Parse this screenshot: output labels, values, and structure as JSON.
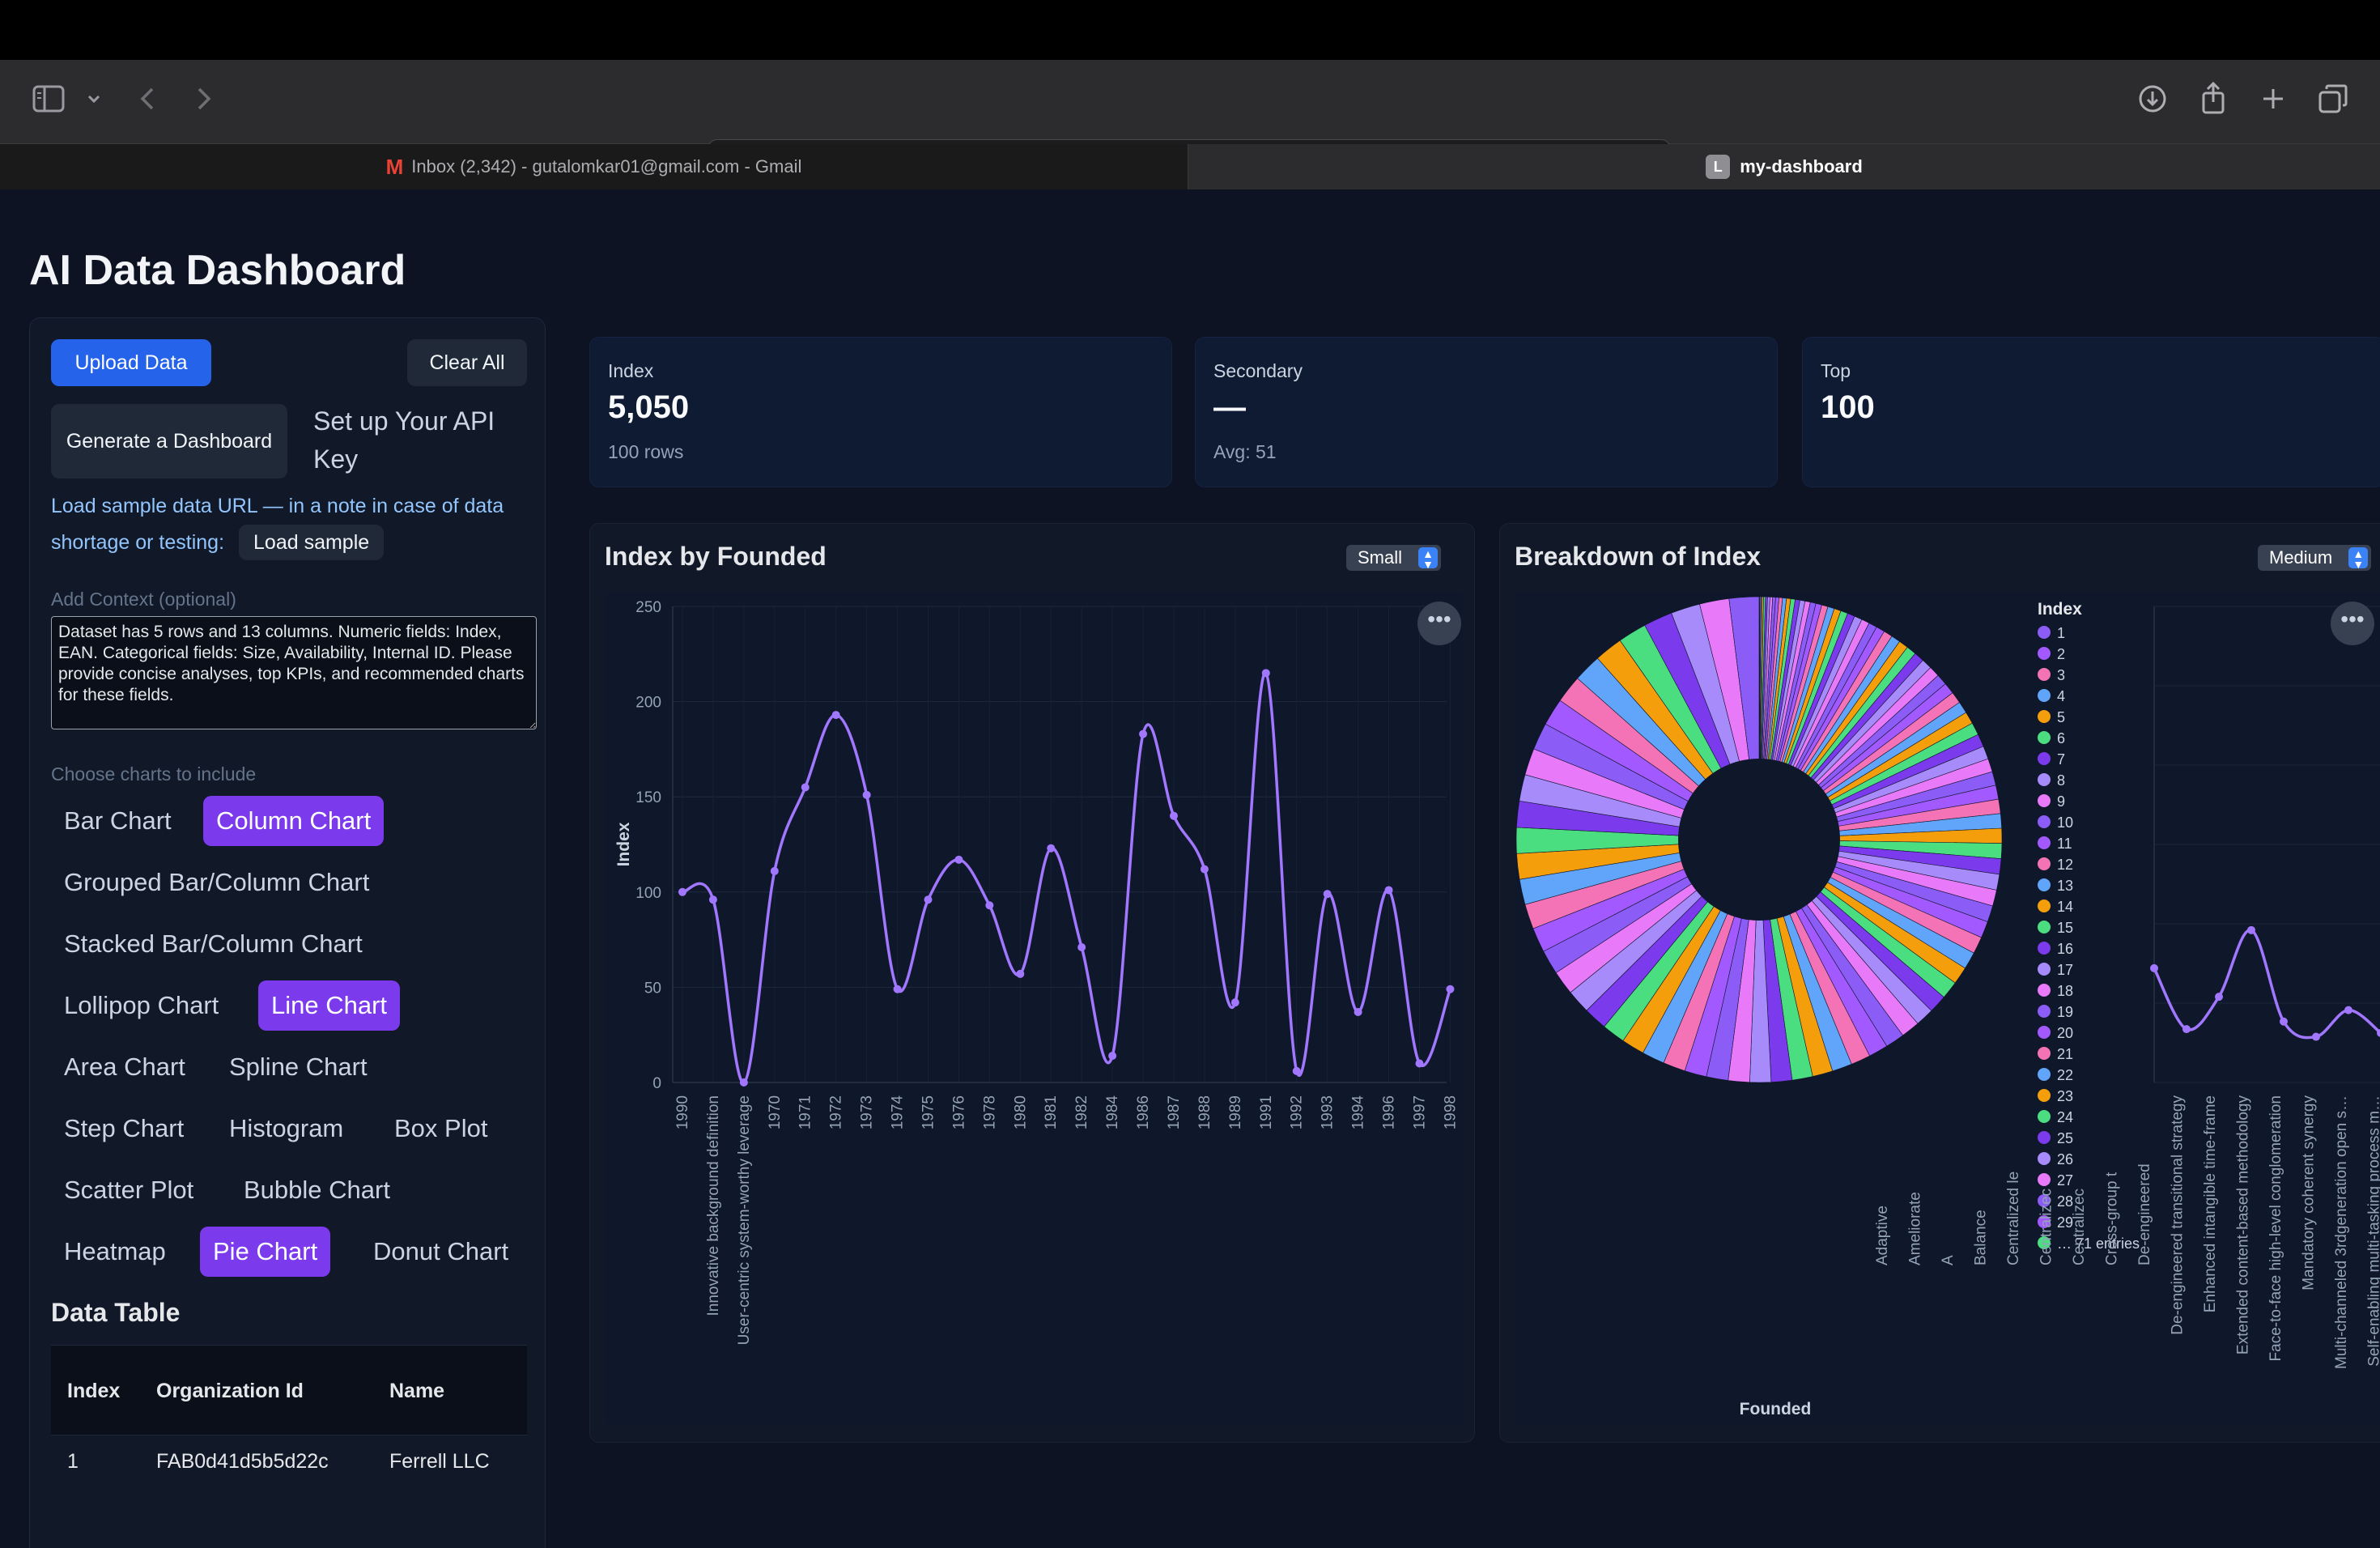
{
  "browser": {
    "url": "localhost",
    "tabs": [
      {
        "title": "Inbox (2,342) - gutalomkar01@gmail.com - Gmail",
        "favicon": "M"
      },
      {
        "title": "my-dashboard",
        "favicon": "L"
      }
    ]
  },
  "page_title": "AI Data Dashboard",
  "sidebar": {
    "upload_label": "Upload Data",
    "clear_label": "Clear All",
    "generate_label": "Generate a Dashboard",
    "api_link": "Set up Your API Key",
    "sample_note": "Load sample data URL — in a note in case of data shortage or testing:",
    "load_sample_label": "Load sample",
    "context_label": "Add Context (optional)",
    "context_value": "Dataset has 5 rows and 13 columns. Numeric fields: Index, EAN. Categorical fields: Size, Availability, Internal ID. Please provide concise analyses, top KPIs, and recommended charts for these fields.",
    "choose_label": "Choose charts to include",
    "chart_options": [
      {
        "label": "Bar Chart",
        "selected": false
      },
      {
        "label": "Column Chart",
        "selected": true
      },
      {
        "label": "Grouped Bar/Column Chart",
        "selected": false
      },
      {
        "label": "Stacked Bar/Column Chart",
        "selected": false
      },
      {
        "label": "Lollipop Chart",
        "selected": false
      },
      {
        "label": "Line Chart",
        "selected": true
      },
      {
        "label": "Area Chart",
        "selected": false
      },
      {
        "label": "Spline Chart",
        "selected": false
      },
      {
        "label": "Step Chart",
        "selected": false
      },
      {
        "label": "Histogram",
        "selected": false
      },
      {
        "label": "Box Plot",
        "selected": false
      },
      {
        "label": "Scatter Plot",
        "selected": false
      },
      {
        "label": "Bubble Chart",
        "selected": false
      },
      {
        "label": "Heatmap",
        "selected": false
      },
      {
        "label": "Pie Chart",
        "selected": true
      },
      {
        "label": "Donut Chart",
        "selected": false
      }
    ],
    "table_title": "Data Table",
    "table_headers": [
      "Index",
      "Organization Id",
      "Name"
    ],
    "table_rows": [
      [
        "1",
        "FAB0d41d5b5d22c",
        "Ferrell LLC"
      ]
    ]
  },
  "kpis": [
    {
      "label": "Index",
      "value": "5,050",
      "sub": "100 rows"
    },
    {
      "label": "Secondary",
      "value": "—",
      "sub": "Avg: 51"
    },
    {
      "label": "Top",
      "value": "100",
      "sub": ""
    }
  ],
  "cards": [
    {
      "title": "Index by Founded",
      "size": "Small"
    },
    {
      "title": "Breakdown of Index",
      "size": "Medium"
    }
  ],
  "icons": [
    "sidebar-icon",
    "chevron-down-icon",
    "back-icon",
    "forward-icon",
    "site-settings-icon",
    "reload-icon",
    "download-icon",
    "share-icon",
    "new-tab-icon",
    "tab-overview-icon",
    "more-icon"
  ],
  "colors": {
    "accent_blue": "#2563eb",
    "accent_purple": "#7c3aed",
    "line": "#a277ff",
    "page_bg": "#0d1322"
  },
  "chart_data": [
    {
      "type": "line",
      "title": "Index by Founded",
      "ylabel": "Index",
      "xlabel": "",
      "ylim": [
        0,
        250
      ],
      "yticks": [
        0,
        50,
        100,
        150,
        200,
        250
      ],
      "categories": [
        "1990",
        "Innovative background definition",
        "User-centric system-worthy leverage",
        "1970",
        "1971",
        "1972",
        "1973",
        "1974",
        "1975",
        "1976",
        "1978",
        "1980",
        "1981",
        "1982",
        "1984",
        "1986",
        "1987",
        "1988",
        "1989",
        "1991",
        "1992",
        "1993",
        "1994",
        "1996",
        "1997",
        "1998"
      ],
      "values": [
        100,
        96,
        0,
        111,
        155,
        193,
        151,
        49,
        96,
        117,
        93,
        57,
        123,
        71,
        14,
        183,
        140,
        112,
        42,
        215,
        6,
        99,
        37,
        101,
        10,
        49
      ],
      "grid": true,
      "smooth": true
    },
    {
      "type": "pie",
      "title": "Breakdown of Index",
      "legend_title": "Index",
      "legend_position": "right",
      "legend_visible": [
        "1",
        "2",
        "3",
        "4",
        "5",
        "6",
        "7",
        "8",
        "9",
        "10",
        "11",
        "12",
        "13",
        "14",
        "15",
        "16",
        "17",
        "18",
        "19",
        "20",
        "21",
        "22",
        "23",
        "24",
        "25",
        "26",
        "27",
        "28",
        "29"
      ],
      "legend_more": "… 71 entries",
      "slice_count": 100,
      "slice_values_are_index": true,
      "palette": [
        "#8b5cf6",
        "#a259ff",
        "#f472b6",
        "#60a5fa",
        "#f59e0b",
        "#4ade80",
        "#7c3aed",
        "#a78bfa",
        "#e879f9"
      ]
    },
    {
      "type": "line",
      "title": "",
      "xlabel": "Founded",
      "categories_partial": [
        "Adaptive",
        "Ameliorate",
        "A",
        "Balance",
        "Centralized le",
        "Centralizec",
        "Centralizec",
        "Cross-group t",
        "De-engineered",
        "De-engineered transitional strategy",
        "Enhanced intangible time-frame",
        "Extended content-based methodology",
        "Face-to-face high-level conglomeration",
        "Mandatory coherent synergy",
        "Multi-channeled 3rdgeneration open s…",
        "Self-enabling multi-tasking process m…"
      ],
      "visible_values_partial": [
        60,
        28,
        45,
        80,
        32,
        24,
        38,
        26
      ]
    }
  ]
}
